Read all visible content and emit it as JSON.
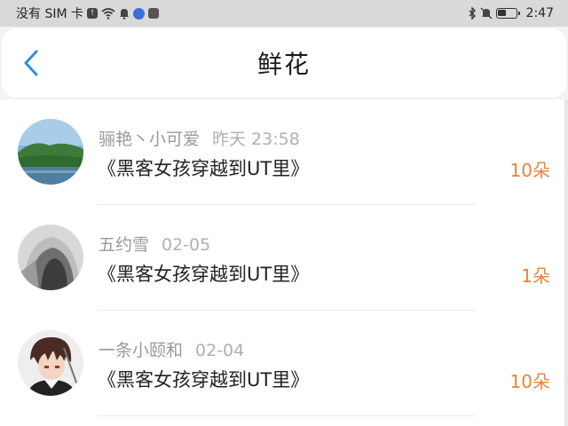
{
  "status_bar": {
    "carrier": "没有 SIM 卡",
    "time": "2:47",
    "battery_level": 0.45,
    "icons": [
      "sim-alert-icon",
      "wifi-icon",
      "notification-bell-icon",
      "app-icon",
      "message-icon",
      "bluetooth-icon",
      "mute-icon",
      "battery-icon"
    ]
  },
  "header": {
    "back_icon": "chevron-left-icon",
    "title": "鲜花"
  },
  "list": {
    "items": [
      {
        "user": "骊艳丶小可爱",
        "time": "昨天 23:58",
        "book": "《黑客女孩穿越到UT里》",
        "count": "10朵",
        "avatar": "landscape"
      },
      {
        "user": "五约雪",
        "time": "02-05",
        "book": "《黑客女孩穿越到UT里》",
        "count": "1朵",
        "avatar": "hooded-figure"
      },
      {
        "user": "一条小颐和",
        "time": "02-04",
        "book": "《黑客女孩穿越到UT里》",
        "count": "10朵",
        "avatar": "anime-character"
      }
    ]
  },
  "colors": {
    "accent": "#2b90d9",
    "count": "#e8833a",
    "status_bar_bg": "#d9d9d9"
  }
}
